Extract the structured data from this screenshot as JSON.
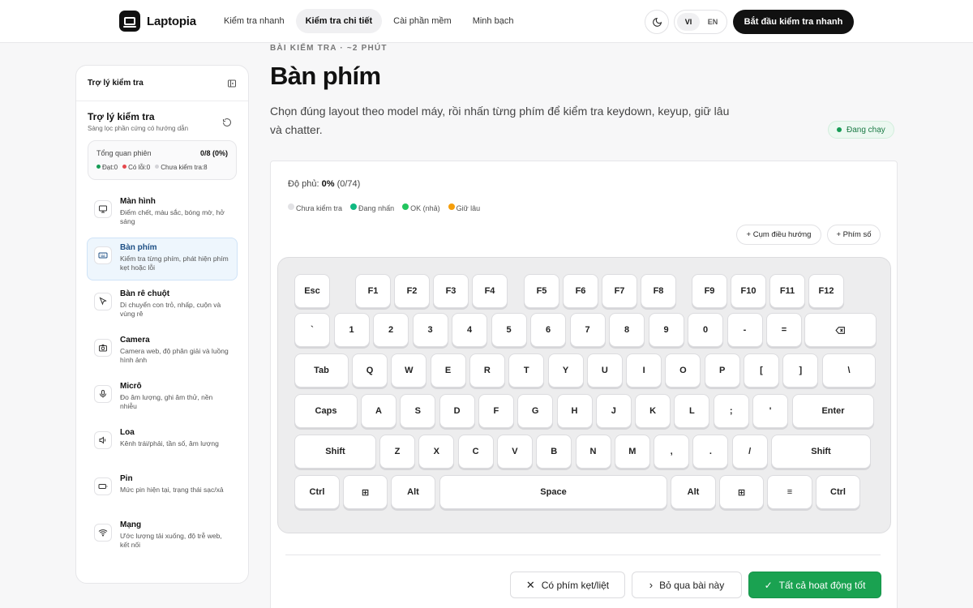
{
  "header": {
    "logo_text": "Laptopia",
    "nav": [
      {
        "label": "Kiểm tra nhanh",
        "active": false
      },
      {
        "label": "Kiểm tra chi tiết",
        "active": true
      },
      {
        "label": "Cài phần mềm",
        "active": false
      },
      {
        "label": "Minh bạch",
        "active": false
      }
    ],
    "lang": {
      "vi": "VI",
      "en": "EN",
      "selected": "VI"
    },
    "cta_label": "Bắt đầu kiểm tra nhanh"
  },
  "sidebar": {
    "header_title": "Trợ lý kiểm tra",
    "title": "Trợ lý kiểm tra",
    "subtitle": "Sàng lọc phần cứng có hướng dẫn",
    "overview": {
      "label": "Tổng quan phiên",
      "value": "0/8 (0%)",
      "pass": "Đạt:0",
      "fail": "Có lỗi:0",
      "pending": "Chưa kiểm tra:8"
    },
    "items": [
      {
        "title": "Màn hình",
        "desc": "Điểm chết, màu sắc, bóng mờ, hở sáng",
        "icon": "monitor-icon",
        "active": false
      },
      {
        "title": "Bàn phím",
        "desc": "Kiểm tra từng phím, phát hiện phím kẹt hoặc lỗi",
        "icon": "keyboard-icon",
        "active": true
      },
      {
        "title": "Bàn rê chuột",
        "desc": "Di chuyển con trỏ, nhấp, cuộn và vùng rê",
        "icon": "cursor-icon",
        "active": false
      },
      {
        "title": "Camera",
        "desc": "Camera web, độ phân giải và luồng hình ảnh",
        "icon": "camera-icon",
        "active": false
      },
      {
        "title": "Micrô",
        "desc": "Đo âm lượng, ghi âm thử, nền nhiễu",
        "icon": "microphone-icon",
        "active": false
      },
      {
        "title": "Loa",
        "desc": "Kênh trái/phải, tần số, âm lượng",
        "icon": "speaker-icon",
        "active": false
      },
      {
        "title": "Pin",
        "desc": "Mức pin hiện tại, trạng thái sạc/xả",
        "icon": "battery-icon",
        "active": false
      },
      {
        "title": "Mạng",
        "desc": "Ước lượng tải xuống, độ trễ web, kết nối",
        "icon": "wifi-icon",
        "active": false
      }
    ]
  },
  "main": {
    "eyebrow": "BÀI KIỂM TRA · ~2 PHÚT",
    "title": "Bàn phím",
    "lead": "Chọn đúng layout theo model máy, rồi nhấn từng phím để kiểm tra keydown, keyup, giữ lâu và chatter.",
    "status": "Đang chạy",
    "status_color": "#169c55",
    "coverage_label": "Độ phủ:",
    "coverage_pct": "0%",
    "coverage_count": "(0/74)",
    "legend": [
      {
        "label": "Chưa kiểm tra",
        "color": "#e2e2e5"
      },
      {
        "label": "Đang nhấn",
        "color": "#10b981"
      },
      {
        "label": "OK (nhả)",
        "color": "#22c55e"
      },
      {
        "label": "Giữ lâu",
        "color": "#f59e0b"
      }
    ],
    "btn_nav_cluster": "+ Cụm điều hướng",
    "btn_numpad": "+ Phím số",
    "keyboard": [
      [
        "Esc",
        "F1",
        "F2",
        "F3",
        "F4",
        "F5",
        "F6",
        "F7",
        "F8",
        "F9",
        "F10",
        "F11",
        "F12"
      ],
      [
        "`",
        "1",
        "2",
        "3",
        "4",
        "5",
        "6",
        "7",
        "8",
        "9",
        "0",
        "-",
        "=",
        "⌫"
      ],
      [
        "Tab",
        "Q",
        "W",
        "E",
        "R",
        "T",
        "Y",
        "U",
        "I",
        "O",
        "P",
        "[",
        "]",
        "\\"
      ],
      [
        "Caps",
        "A",
        "S",
        "D",
        "F",
        "G",
        "H",
        "J",
        "K",
        "L",
        ";",
        "'",
        "Enter"
      ],
      [
        "Shift",
        "Z",
        "X",
        "C",
        "V",
        "B",
        "N",
        "M",
        ",",
        ".",
        "/",
        "Shift"
      ],
      [
        "Ctrl",
        "⊞",
        "Alt",
        "Space",
        "Alt",
        "⊞",
        "≡",
        "Ctrl"
      ]
    ],
    "actions": {
      "stuck": "Có phím kẹt/liệt",
      "skip": "Bỏ qua bài này",
      "all_good": "Tất cả hoạt động tốt"
    }
  }
}
